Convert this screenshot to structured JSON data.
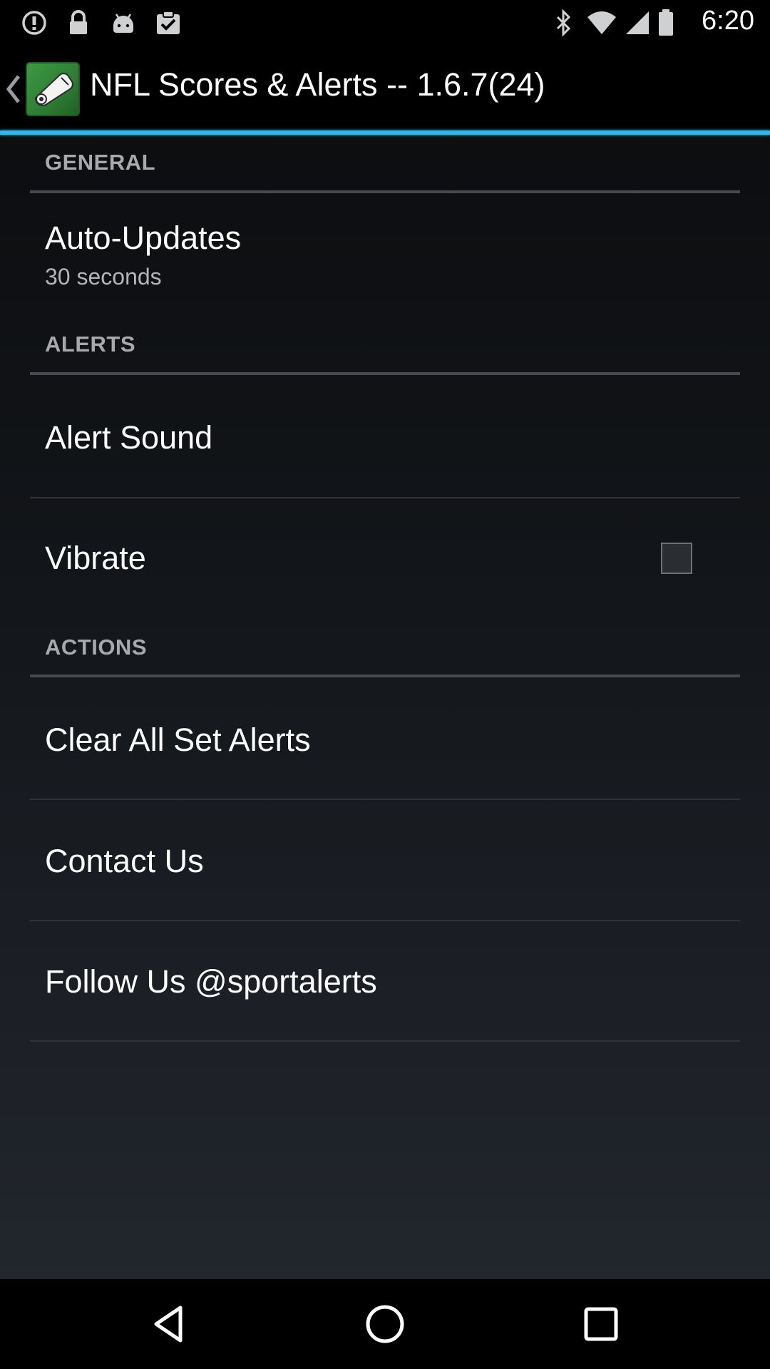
{
  "status_bar": {
    "time": "6:20",
    "icons": [
      "info-icon",
      "lock-icon",
      "android-icon",
      "clipboard-check-icon",
      "bluetooth-icon",
      "wifi-icon",
      "signal-icon",
      "battery-icon"
    ]
  },
  "action_bar": {
    "title": "NFL Scores & Alerts -- 1.6.7(24)",
    "accent_color": "#33b5e5"
  },
  "sections": {
    "general": {
      "header": "GENERAL",
      "auto_updates": {
        "title": "Auto-Updates",
        "summary": "30 seconds"
      }
    },
    "alerts": {
      "header": "ALERTS",
      "alert_sound": {
        "title": "Alert Sound"
      },
      "vibrate": {
        "title": "Vibrate",
        "checked": false
      }
    },
    "actions": {
      "header": "ACTIONS",
      "clear_all": {
        "title": "Clear All Set Alerts"
      },
      "contact_us": {
        "title": "Contact Us"
      },
      "follow_us": {
        "title": "Follow Us @sportalerts"
      }
    }
  },
  "nav_bar": {
    "buttons": [
      "back-icon",
      "home-icon",
      "recents-icon"
    ]
  }
}
